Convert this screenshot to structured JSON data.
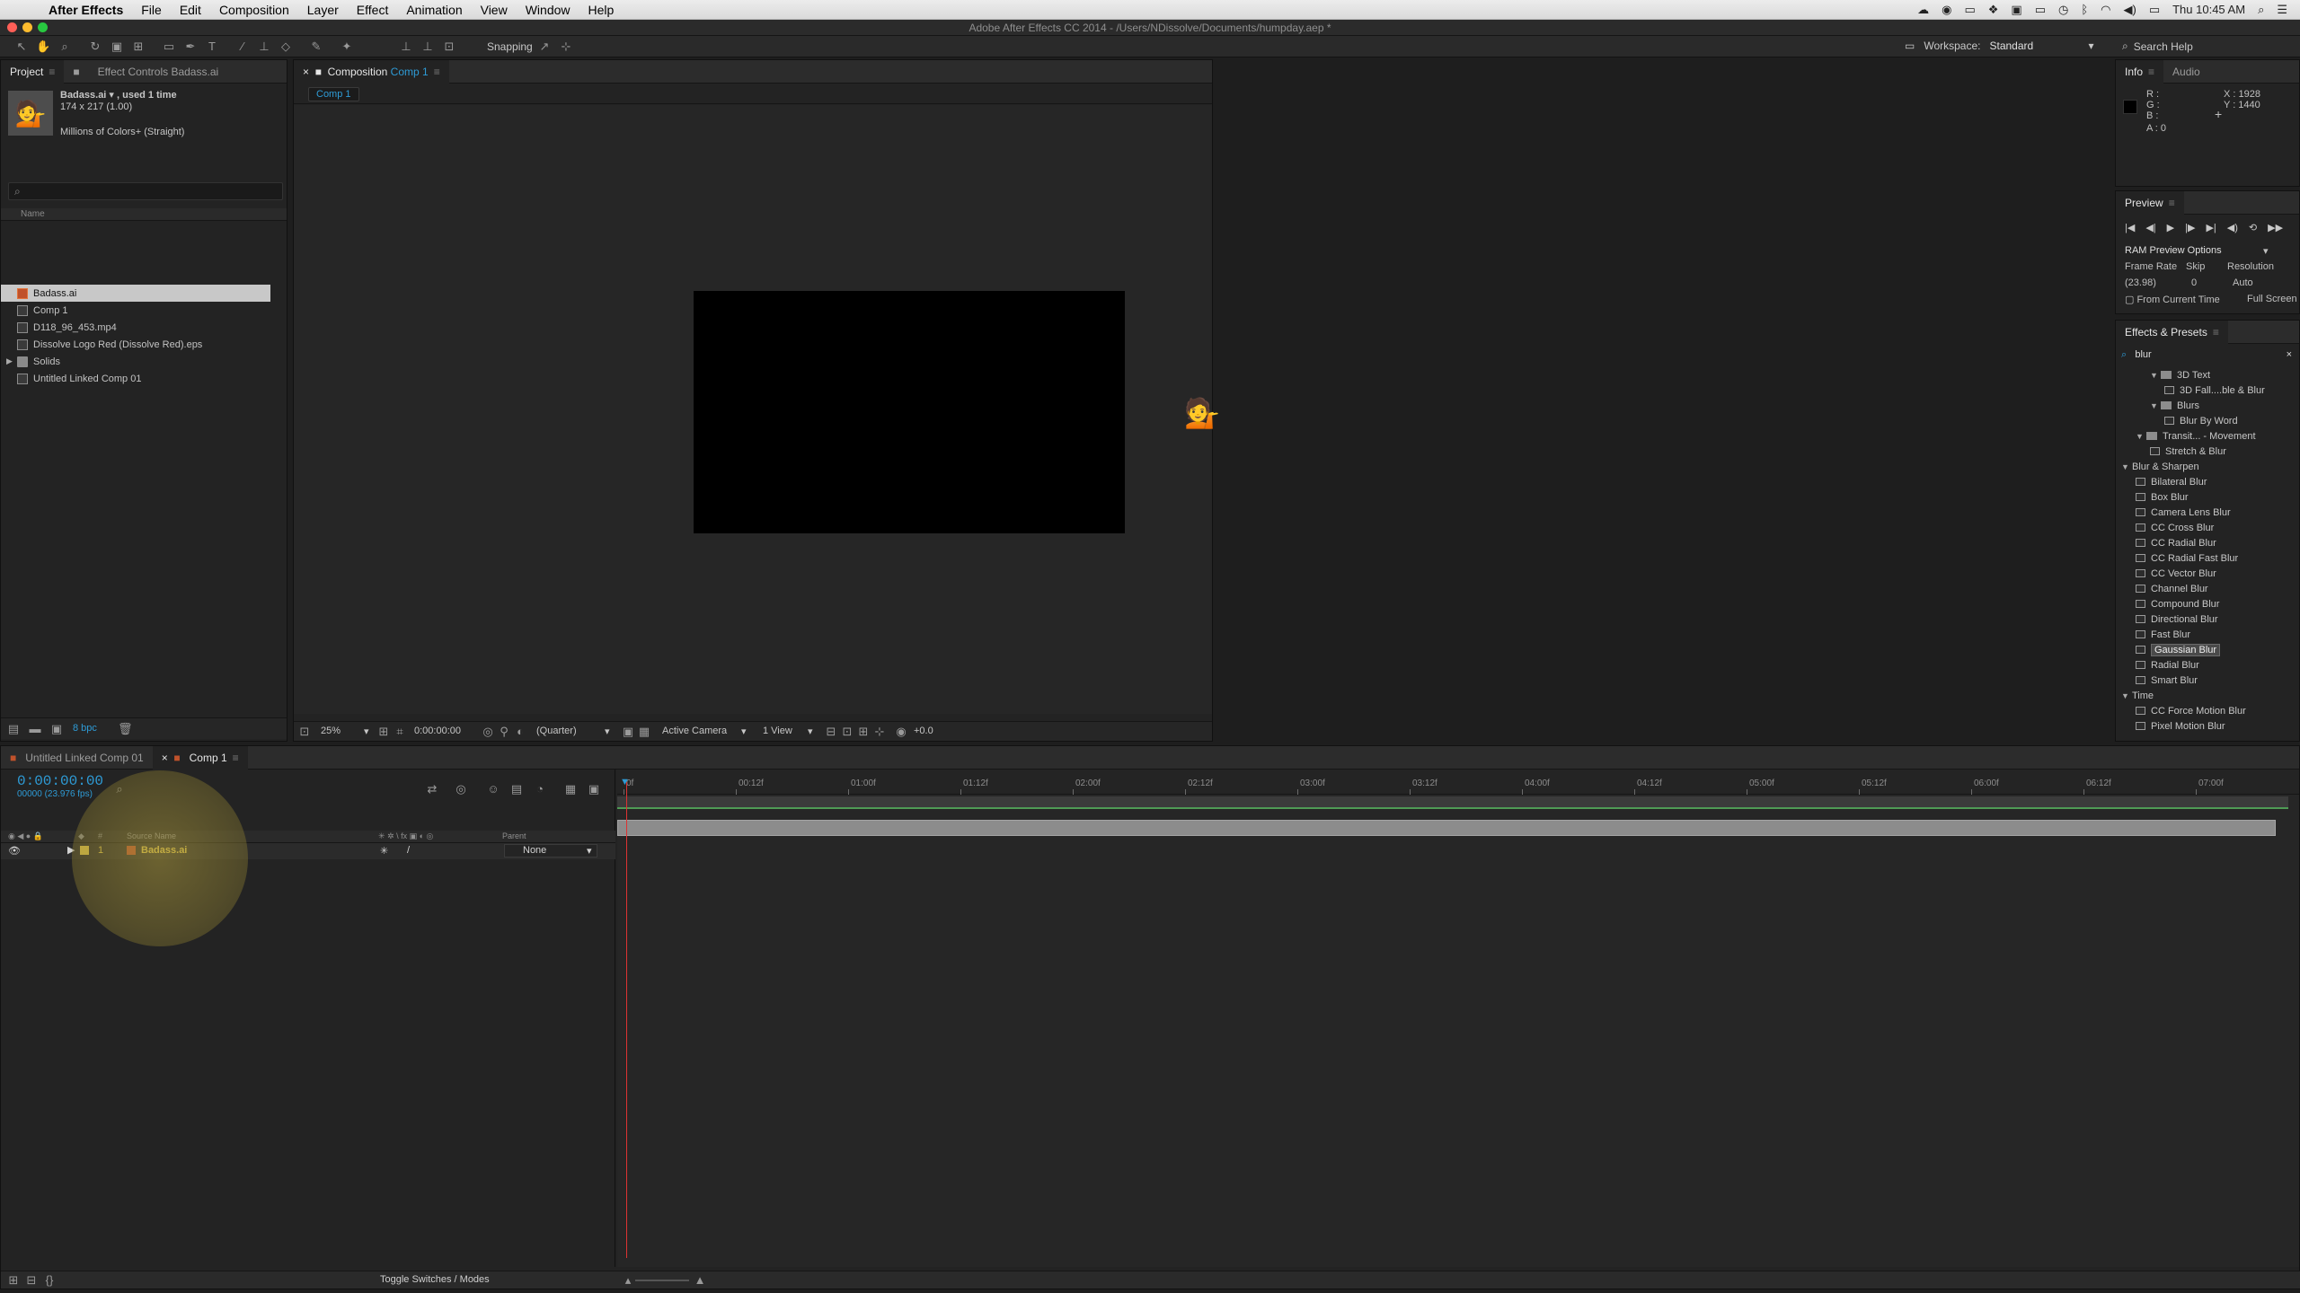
{
  "menubar": {
    "app": "After Effects",
    "items": [
      "File",
      "Edit",
      "Composition",
      "Layer",
      "Effect",
      "Animation",
      "View",
      "Window",
      "Help"
    ],
    "clock": "Thu 10:45 AM"
  },
  "window": {
    "title": "Adobe After Effects CC 2014 - /Users/NDissolve/Documents/humpday.aep *"
  },
  "toolbar": {
    "snapping": "Snapping",
    "workspace_label": "Workspace:",
    "workspace_value": "Standard",
    "search_help": "Search Help"
  },
  "project": {
    "tabs": [
      "Project",
      "Effect Controls Badass.ai"
    ],
    "selected": {
      "name": "Badass.ai ▾ , used 1 time",
      "size": "174 x 217 (1.00)",
      "colors": "Millions of Colors+ (Straight)"
    },
    "search_placeholder": "",
    "column_name": "Name",
    "items": [
      {
        "label": "Badass.ai",
        "type": "ai",
        "selected": true
      },
      {
        "label": "Comp 1",
        "type": "comp"
      },
      {
        "label": "D118_96_453.mp4",
        "type": "file"
      },
      {
        "label": "Dissolve Logo Red (Dissolve Red).eps",
        "type": "file"
      },
      {
        "label": "Solids",
        "type": "folder"
      },
      {
        "label": "Untitled Linked Comp 01",
        "type": "comp"
      }
    ],
    "bpc": "8 bpc"
  },
  "composition": {
    "tab_prefix": "Composition",
    "tab_name": "Comp 1",
    "sub_tab": "Comp 1",
    "footer": {
      "zoom": "25%",
      "time": "0:00:00:00",
      "resolution": "(Quarter)",
      "camera": "Active Camera",
      "views": "1 View",
      "exposure": "+0.0"
    }
  },
  "info": {
    "tabs": [
      "Info",
      "Audio"
    ],
    "r": "R :",
    "g": "G :",
    "b": "B :",
    "a": "A : 0",
    "x": "X : 1928",
    "y": "Y : 1440"
  },
  "preview": {
    "tab": "Preview",
    "ram_options": "RAM Preview Options",
    "frame_rate_label": "Frame Rate",
    "skip_label": "Skip",
    "resolution_label": "Resolution",
    "frame_rate": "(23.98)",
    "skip": "0",
    "resolution": "Auto",
    "from_current": "From Current Time",
    "full_screen": "Full Screen"
  },
  "effects": {
    "tab": "Effects & Presets",
    "search": "blur",
    "items": [
      {
        "label": "3D Text",
        "indent": 2,
        "kind": "folder",
        "open": true
      },
      {
        "label": "3D Fall....ble & Blur",
        "indent": 3,
        "kind": "preset"
      },
      {
        "label": "Blurs",
        "indent": 2,
        "kind": "folder",
        "open": true
      },
      {
        "label": "Blur By Word",
        "indent": 3,
        "kind": "preset"
      },
      {
        "label": "Transit... - Movement",
        "indent": 1,
        "kind": "folder",
        "open": true
      },
      {
        "label": "Stretch & Blur",
        "indent": 2,
        "kind": "preset"
      },
      {
        "label": "Blur & Sharpen",
        "indent": 0,
        "kind": "category",
        "open": true
      },
      {
        "label": "Bilateral Blur",
        "indent": 1,
        "kind": "effect"
      },
      {
        "label": "Box Blur",
        "indent": 1,
        "kind": "effect"
      },
      {
        "label": "Camera Lens Blur",
        "indent": 1,
        "kind": "effect"
      },
      {
        "label": "CC Cross Blur",
        "indent": 1,
        "kind": "effect"
      },
      {
        "label": "CC Radial Blur",
        "indent": 1,
        "kind": "effect"
      },
      {
        "label": "CC Radial Fast Blur",
        "indent": 1,
        "kind": "effect"
      },
      {
        "label": "CC Vector Blur",
        "indent": 1,
        "kind": "effect"
      },
      {
        "label": "Channel Blur",
        "indent": 1,
        "kind": "effect"
      },
      {
        "label": "Compound Blur",
        "indent": 1,
        "kind": "effect"
      },
      {
        "label": "Directional Blur",
        "indent": 1,
        "kind": "effect"
      },
      {
        "label": "Fast Blur",
        "indent": 1,
        "kind": "effect"
      },
      {
        "label": "Gaussian Blur",
        "indent": 1,
        "kind": "effect",
        "selected": true
      },
      {
        "label": "Radial Blur",
        "indent": 1,
        "kind": "effect"
      },
      {
        "label": "Smart Blur",
        "indent": 1,
        "kind": "effect"
      },
      {
        "label": "Time",
        "indent": 0,
        "kind": "category",
        "open": true
      },
      {
        "label": "CC Force Motion Blur",
        "indent": 1,
        "kind": "effect"
      },
      {
        "label": "Pixel Motion Blur",
        "indent": 1,
        "kind": "effect"
      }
    ]
  },
  "timeline": {
    "tabs": [
      "Untitled Linked Comp 01",
      "Comp 1"
    ],
    "time": "0:00:00:00",
    "fps": "00000 (23.976 fps)",
    "col_source": "Source Name",
    "col_parent": "Parent",
    "layer": {
      "num": "1",
      "name": "Badass.ai",
      "parent": "None"
    },
    "ruler": [
      "0f",
      "00:12f",
      "01:00f",
      "01:12f",
      "02:00f",
      "02:12f",
      "03:00f",
      "03:12f",
      "04:00f",
      "04:12f",
      "05:00f",
      "05:12f",
      "06:00f",
      "06:12f",
      "07:00f"
    ],
    "toggle": "Toggle Switches / Modes"
  },
  "colors": {
    "accent": "#2e9bd6",
    "label_yellow": "#e5c94b",
    "cti": "#dd3333"
  }
}
